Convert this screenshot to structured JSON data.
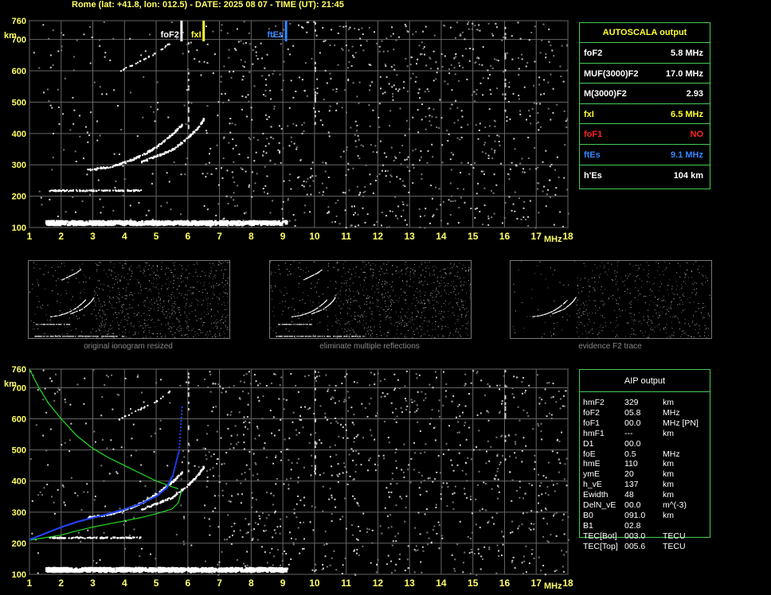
{
  "header": "Rome (lat: +41.8, lon: 012.5) - DATE: 2025 08 07 - TIME (UT): 21:45",
  "autoscala": {
    "title": "AUTOSCALA output",
    "rows": [
      {
        "label": "foF2",
        "value": "5.8 MHz",
        "color": "#ffffff"
      },
      {
        "label": "MUF(3000)F2",
        "value": "17.0 MHz",
        "color": "#ffffff"
      },
      {
        "label": "M(3000)F2",
        "value": "2.93",
        "color": "#ffffff"
      },
      {
        "label": "fxI",
        "value": "6.5 MHz",
        "color": "#ffff33"
      },
      {
        "label": "foF1",
        "value": "NO",
        "color": "#ff2222"
      },
      {
        "label": "ftEs",
        "value": "9.1 MHz",
        "color": "#3388ff"
      },
      {
        "label": "h'Es",
        "value": "104    km",
        "color": "#ffffff"
      }
    ]
  },
  "aip": {
    "title": "AIP output",
    "rows": [
      {
        "label": "hmF2",
        "value": "329",
        "unit": "km"
      },
      {
        "label": "foF2",
        "value": "05.8",
        "unit": "MHz"
      },
      {
        "label": "foF1",
        "value": "00.0",
        "unit": "MHz    [PN]"
      },
      {
        "label": "hmF1",
        "value": "---",
        "unit": "km"
      },
      {
        "label": "D1",
        "value": "00.0",
        "unit": ""
      },
      {
        "label": "foE",
        "value": "0.5",
        "unit": "MHz"
      },
      {
        "label": "hmE",
        "value": "110",
        "unit": "km"
      },
      {
        "label": "ymE",
        "value": "20",
        "unit": "km"
      },
      {
        "label": "h_vE",
        "value": "137",
        "unit": "km"
      },
      {
        "label": "Ewidth",
        "value": "48",
        "unit": "km"
      },
      {
        "label": "DelN_vE",
        "value": "00.0",
        "unit": "m^(-3)"
      },
      {
        "label": "B0",
        "value": "091.0",
        "unit": "km"
      },
      {
        "label": "B1",
        "value": "02.8",
        "unit": ""
      },
      {
        "label": "TEC[Bot]",
        "value": "003.0",
        "unit": "TECU"
      },
      {
        "label": "TEC[Top]",
        "value": "005.6",
        "unit": "TECU"
      }
    ]
  },
  "thumbnails": [
    {
      "caption": "original ionogram resized"
    },
    {
      "caption": "eliminate multiple reflections"
    },
    {
      "caption": "evidence F2 trace"
    }
  ],
  "markers": [
    {
      "label": "foF2",
      "freq": 5.8,
      "color": "#ffffff"
    },
    {
      "label": "fxI",
      "freq": 6.5,
      "color": "#ffff33"
    },
    {
      "label": "ftEs",
      "freq": 9.1,
      "color": "#3388ff"
    }
  ],
  "chart_data": {
    "type": "scatter",
    "xlabel": "MHz",
    "ylabel": "km",
    "xlim": [
      1,
      18
    ],
    "ylim": [
      100,
      760
    ],
    "xticks": [
      1,
      2,
      3,
      4,
      5,
      6,
      7,
      8,
      9,
      10,
      11,
      12,
      13,
      14,
      15,
      16,
      17,
      18
    ],
    "yticks": [
      100,
      200,
      300,
      400,
      500,
      600,
      700,
      760
    ],
    "grid": true,
    "traces": {
      "es_layer": {
        "x": [
          1.5,
          2,
          3,
          4,
          5,
          6,
          7,
          8,
          9.1
        ],
        "y": [
          118,
          118,
          118,
          118,
          118,
          118,
          118,
          118,
          118
        ]
      },
      "e_layer_echo": {
        "x": [
          1.6,
          2.5,
          3.5,
          4.5
        ],
        "y": [
          220,
          220,
          220,
          220
        ]
      },
      "f2_ordinary": {
        "x": [
          2.8,
          3.5,
          4,
          4.5,
          5,
          5.5,
          5.8
        ],
        "y": [
          285,
          295,
          310,
          330,
          360,
          400,
          430
        ]
      },
      "f2_extraordinary": {
        "x": [
          4.5,
          5,
          5.5,
          6,
          6.3,
          6.5
        ],
        "y": [
          310,
          330,
          350,
          390,
          420,
          450
        ]
      },
      "f2_multiple": {
        "x": [
          3.8,
          4.2,
          4.6,
          5,
          5.4
        ],
        "y": [
          600,
          620,
          640,
          660,
          690
        ]
      }
    },
    "profile_blue": {
      "x": [
        1,
        1.5,
        2,
        2.5,
        3,
        3.5,
        4,
        4.5,
        5,
        5.3,
        5.5,
        5.7,
        5.8
      ],
      "y": [
        215,
        235,
        255,
        272,
        285,
        298,
        312,
        330,
        355,
        380,
        420,
        500,
        650
      ]
    },
    "profile_green_upper": {
      "x": [
        1,
        1.3,
        1.6,
        2,
        2.5,
        3,
        3.5,
        4,
        4.5,
        5,
        5.5,
        5.7
      ],
      "y": [
        760,
        700,
        650,
        600,
        545,
        505,
        475,
        450,
        425,
        400,
        382,
        375
      ]
    },
    "profile_green_lower": {
      "x": [
        1,
        1.5,
        2,
        2.5,
        3,
        3.5,
        4,
        4.5,
        5,
        5.5,
        5.7,
        5.8
      ],
      "y": [
        210,
        218,
        226,
        240,
        252,
        262,
        272,
        282,
        295,
        310,
        330,
        370
      ]
    }
  }
}
